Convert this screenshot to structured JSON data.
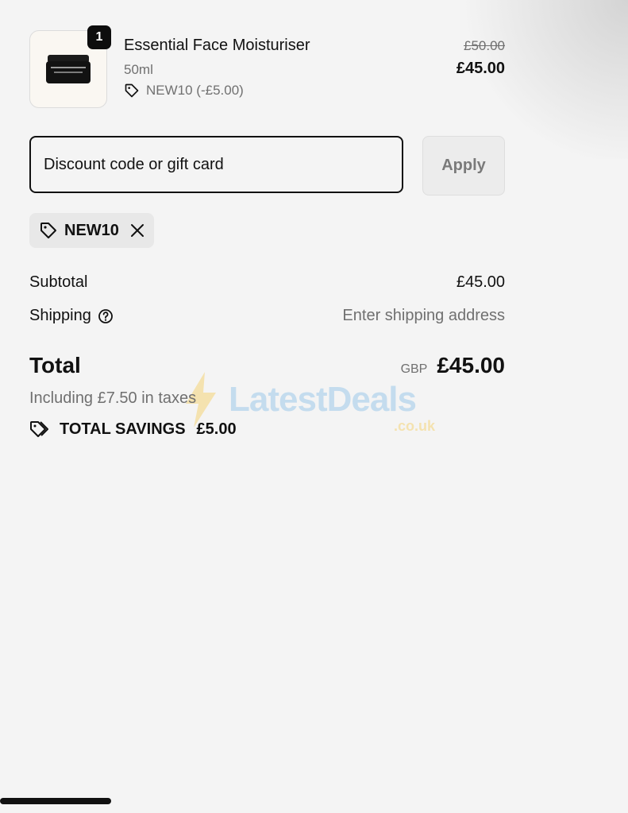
{
  "line_item": {
    "quantity": "1",
    "name": "Essential Face Moisturiser",
    "variant": "50ml",
    "discount_applied": "NEW10 (-£5.00)",
    "original_price": "£50.00",
    "final_price": "£45.00",
    "product_image_icon": "moisturiser-jar-image"
  },
  "discount": {
    "placeholder": "Discount code or gift card",
    "apply_label": "Apply",
    "applied_code": "NEW10"
  },
  "summary": {
    "subtotal_label": "Subtotal",
    "subtotal_value": "£45.00",
    "shipping_label": "Shipping",
    "shipping_value": "Enter shipping address",
    "total_label": "Total",
    "currency": "GBP",
    "total_value": "£45.00",
    "tax_note": "Including £7.50 in taxes",
    "savings_label": "TOTAL SAVINGS",
    "savings_value": "£5.00"
  },
  "watermark": {
    "brand": "LatestDeals",
    "suffix": ".co.uk"
  },
  "colors": {
    "background": "#f4f4f4",
    "text": "#111111",
    "muted": "#707070",
    "watermark_blue": "#4a9fe0",
    "watermark_yellow": "#f5b400"
  }
}
